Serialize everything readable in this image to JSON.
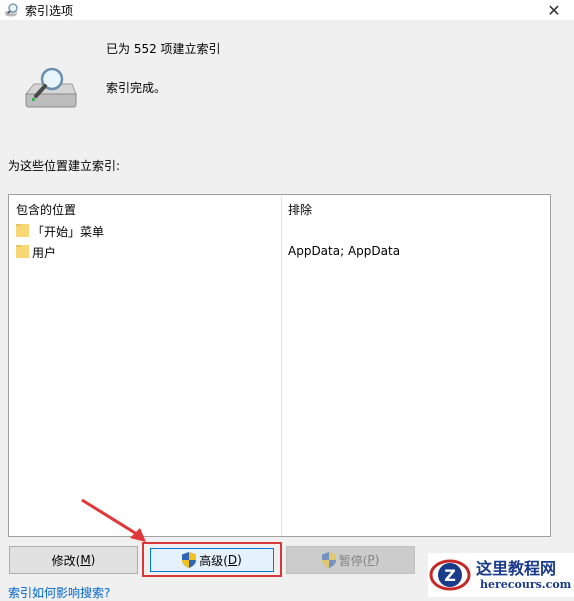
{
  "window": {
    "title": "索引选项",
    "close_glyph": "✕"
  },
  "status": {
    "indexed_count_text": "已为 552 项建立索引",
    "status_text": "索引完成。"
  },
  "locations": {
    "section_label": "为这些位置建立索引:",
    "columns": {
      "included": "包含的位置",
      "excluded": "排除"
    },
    "rows": [
      {
        "name": "「开始」菜单",
        "exclude": ""
      },
      {
        "name": "用户",
        "exclude": "AppData; AppData"
      }
    ]
  },
  "buttons": {
    "modify": {
      "label": "修改(",
      "key": "M",
      "suffix": ")"
    },
    "advanced": {
      "label": "高级(",
      "key": "D",
      "suffix": ")"
    },
    "pause": {
      "label": "暂停(",
      "key": "P",
      "suffix": ")"
    }
  },
  "footer": {
    "link_text": "索引如何影响搜索?"
  },
  "watermark": {
    "title": "这里教程网",
    "subtitle": "herecours.com"
  },
  "colors": {
    "highlight_border": "#d9383a",
    "arrow": "#e0383a",
    "link": "#0066cc",
    "folder": "#f8d775",
    "focus_blue": "#0078d7"
  }
}
